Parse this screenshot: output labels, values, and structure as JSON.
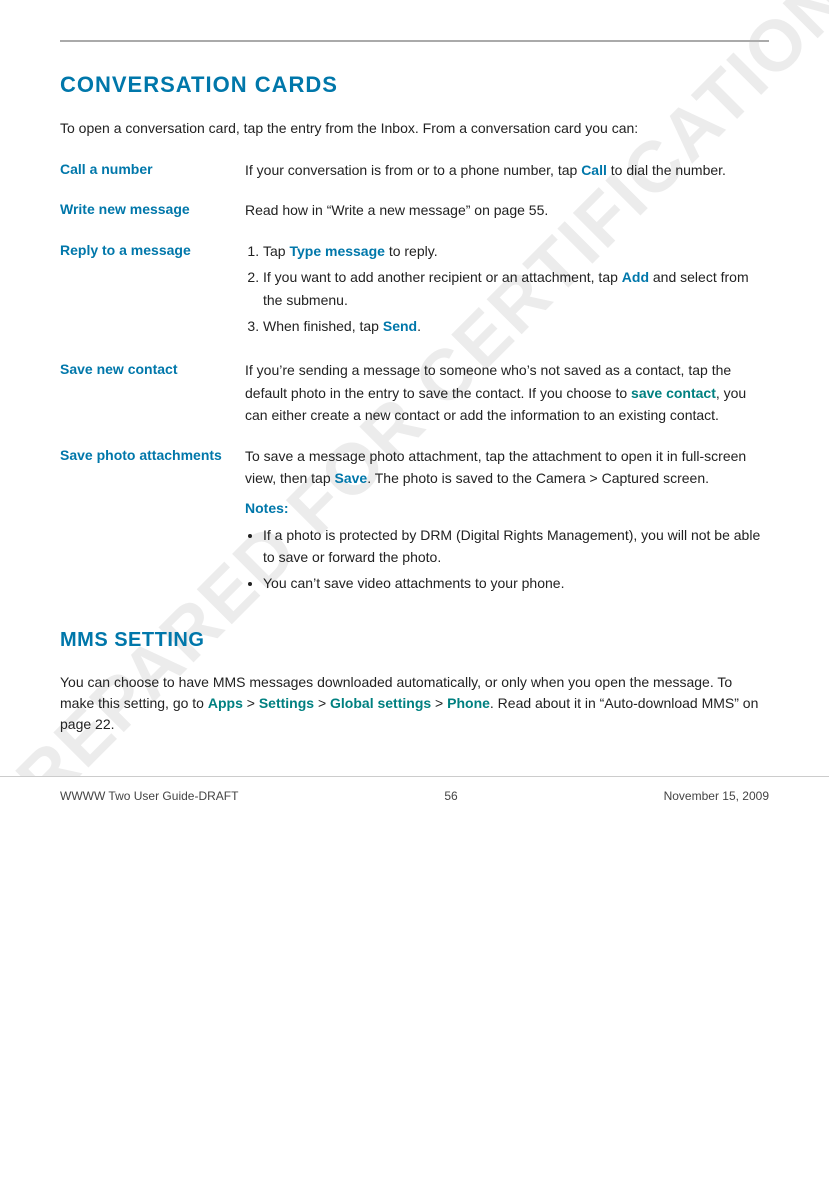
{
  "page": {
    "watermark": "PREPARED FOR CERTIFICATION",
    "top_bar_line": true
  },
  "section1": {
    "title": "CONVERSATION CARDS",
    "intro": "To open a conversation card, tap the entry from the Inbox. From a conversation card you can:"
  },
  "definitions": [
    {
      "term": "Call a number",
      "desc_text": "If your conversation is from or to a phone number, tap ",
      "desc_link": "Call",
      "desc_link_class": "link-blue",
      "desc_after": " to dial the number.",
      "type": "simple"
    },
    {
      "term": "Write new message",
      "desc_text": "Read how in “Write a new message” on page 55.",
      "type": "simple_plain"
    },
    {
      "term": "Reply to a message",
      "type": "ordered",
      "items": [
        {
          "text": "Tap ",
          "link": "Type message",
          "after": " to reply."
        },
        {
          "text": "If you want to add another recipient or an attachment, tap ",
          "link": "Add",
          "after": " and select from the submenu."
        },
        {
          "text": "When finished, tap ",
          "link": "Send",
          "after": "."
        }
      ]
    },
    {
      "term": "Save new contact",
      "type": "paragraph",
      "text": "If you’re sending a message to someone who’s not saved as a contact, tap the default photo in the entry to save the contact. If you choose to ",
      "link": "save contact",
      "after": ", you can either create a new contact or add the information to an existing contact."
    },
    {
      "term": "Save photo attachments",
      "type": "photo_attachments",
      "para": "To save a message photo attachment, tap the attachment to open it in full-screen view, then tap ",
      "para_link": "Save",
      "para_after": ". The photo is saved to the Camera > Captured screen.",
      "notes_label": "Notes:",
      "bullets": [
        "If a photo is protected by DRM (Digital Rights Management), you will not be able to save or forward the photo.",
        "You can’t save video attachments to your phone."
      ]
    }
  ],
  "section2": {
    "title": "MMS SETTING",
    "para1": "You can choose to have MMS messages downloaded automatically, or only when you open the message. To make this setting, go to ",
    "link1": "Apps",
    "sep1": " > ",
    "link2": "Settings",
    "sep2": " > ",
    "link3": "Global settings",
    "sep3": " > ",
    "link4": "Phone",
    "para2": ". Read about it in “Auto-download MMS” on page 22."
  },
  "footer": {
    "left": "WWWW Two User Guide-DRAFT",
    "center": "56",
    "right": "November 15, 2009"
  }
}
